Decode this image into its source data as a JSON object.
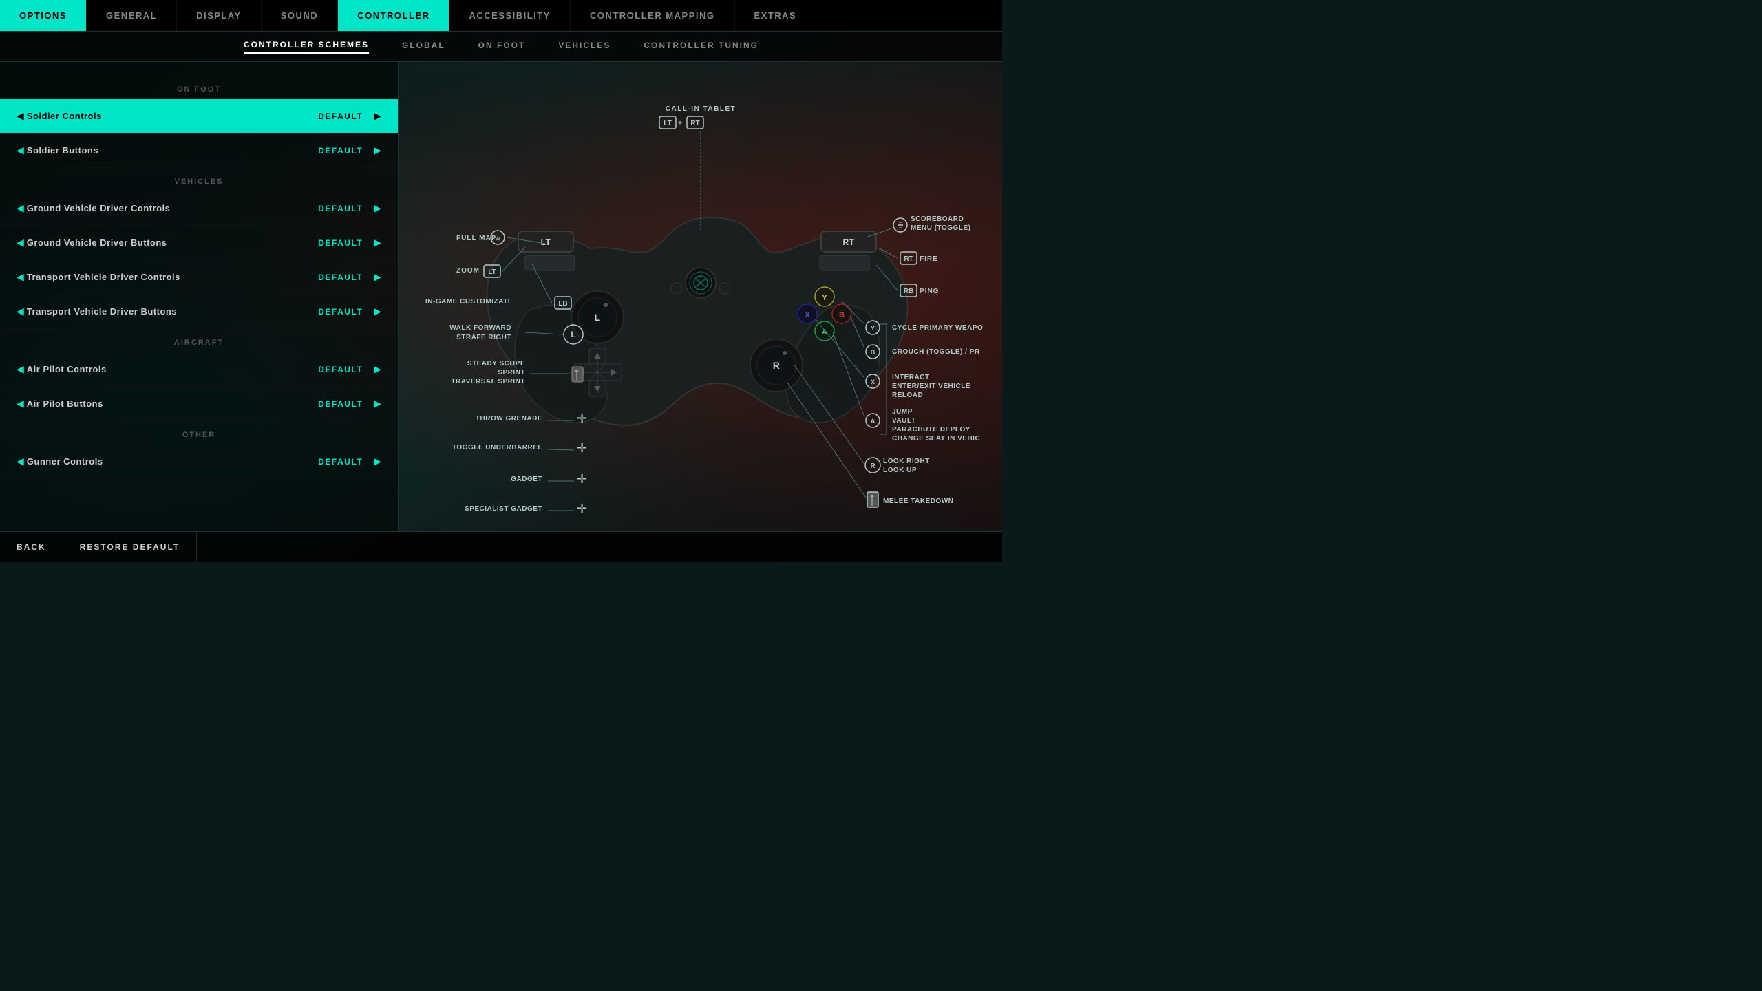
{
  "topNav": {
    "items": [
      {
        "id": "options",
        "label": "OPTIONS",
        "active": true
      },
      {
        "id": "general",
        "label": "GENERAL",
        "active": false
      },
      {
        "id": "display",
        "label": "DISPLAY",
        "active": false
      },
      {
        "id": "sound",
        "label": "SOUND",
        "active": false
      },
      {
        "id": "controller",
        "label": "CONTROLLER",
        "active": true,
        "highlighted": true
      },
      {
        "id": "accessibility",
        "label": "ACCESSIBILITY",
        "active": false
      },
      {
        "id": "controller-mapping",
        "label": "CONTROLLER MAPPING",
        "active": false
      },
      {
        "id": "extras",
        "label": "EXTRAS",
        "active": false
      }
    ]
  },
  "subNav": {
    "items": [
      {
        "id": "schemes",
        "label": "CONTROLLER SCHEMES",
        "active": true
      },
      {
        "id": "global",
        "label": "GLOBAL",
        "active": false
      },
      {
        "id": "on-foot",
        "label": "ON FOOT",
        "active": false
      },
      {
        "id": "vehicles",
        "label": "VEHICLES",
        "active": false
      },
      {
        "id": "tuning",
        "label": "CONTROLLER TUNING",
        "active": false
      }
    ]
  },
  "leftPanel": {
    "sections": [
      {
        "id": "on-foot",
        "label": "ON FOOT",
        "rows": [
          {
            "id": "soldier-controls",
            "name": "Soldier Controls",
            "value": "DEFAULT",
            "selected": true
          },
          {
            "id": "soldier-buttons",
            "name": "Soldier Buttons",
            "value": "DEFAULT",
            "selected": false
          }
        ]
      },
      {
        "id": "vehicles",
        "label": "VEHICLES",
        "rows": [
          {
            "id": "ground-driver-controls",
            "name": "Ground Vehicle Driver Controls",
            "value": "DEFAULT",
            "selected": false
          },
          {
            "id": "ground-driver-buttons",
            "name": "Ground Vehicle Driver Buttons",
            "value": "DEFAULT",
            "selected": false
          },
          {
            "id": "transport-driver-controls",
            "name": "Transport Vehicle Driver Controls",
            "value": "DEFAULT",
            "selected": false
          },
          {
            "id": "transport-driver-buttons",
            "name": "Transport Vehicle Driver Buttons",
            "value": "DEFAULT",
            "selected": false
          }
        ]
      },
      {
        "id": "aircraft",
        "label": "AIRCRAFT",
        "rows": [
          {
            "id": "air-pilot-controls",
            "name": "Air Pilot Controls",
            "value": "DEFAULT",
            "selected": false
          },
          {
            "id": "air-pilot-buttons",
            "name": "Air Pilot Buttons",
            "value": "DEFAULT",
            "selected": false
          }
        ]
      },
      {
        "id": "other",
        "label": "OTHER",
        "rows": [
          {
            "id": "gunner-controls",
            "name": "Gunner Controls",
            "value": "DEFAULT",
            "selected": false
          }
        ]
      }
    ]
  },
  "controllerDiagram": {
    "callinTablet": "CALL-IN TABLET",
    "callinButtons": "LT + RT",
    "fullMap": "FULL MAP",
    "zoom": "ZOOM",
    "zoomBtn": "LT",
    "inGameCustom": "IN-GAME CUSTOMIZATI",
    "inGameBtn": "LB",
    "scoreboard": "SCOREBOARD MENU (TOGGLE)",
    "fireBtn": "RT",
    "fireLabel": "FIRE",
    "pingBtn": "RB",
    "pingLabel": "PING",
    "walkForward": "WALK FORWARD",
    "strafeRight": "STRAFE RIGHT",
    "leftStickBtn": "L",
    "steadyScope": "STEADY SCOPE",
    "sprint": "SPRINT",
    "traversalSprint": "TRAVERSAL SPRINT",
    "throwGrenade": "THROW GRENADE",
    "toggleUnderbarrel": "TOGGLE UNDERBARREL",
    "gadget": "GADGET",
    "specialistGadget": "SPECIALIST GADGET",
    "cyclePrimary": "CYCLE PRIMARY WEAPO",
    "cycleBtn": "Y",
    "crouchToggle": "CROUCH (TOGGLE) / PR",
    "crouchBtn": "B",
    "interact": "INTERACT",
    "enterExitVehicle": "ENTER/EXIT VEHICLE",
    "reload": "RELOAD",
    "interactBtn": "X",
    "jump": "JUMP",
    "vault": "VAULT",
    "parachuteDeploy": "PARACHUTE DEPLOY",
    "changeSeat": "CHANGE SEAT IN VEHIC",
    "jumpBtn": "A",
    "lookRight": "LOOK RIGHT",
    "lookUp": "LOOK UP",
    "rightStickBtn": "R",
    "meleeTakedown": "MELEE TAKEDOWN",
    "meleeTakedownBtn": "R"
  },
  "bottomBar": {
    "backLabel": "BACK",
    "restoreLabel": "RESTORE DEFAULT"
  }
}
